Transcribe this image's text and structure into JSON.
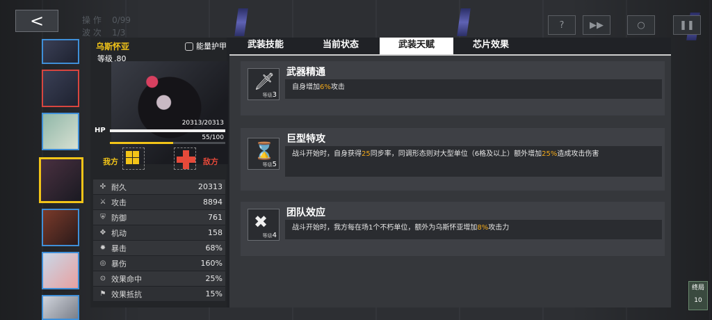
{
  "topbar": {
    "back_label": "<",
    "ops_label": "操 作",
    "ops_value": "0/99",
    "wave_label": "波 次",
    "wave_value": "1/3",
    "buttons": [
      "?",
      "▶▶",
      "○",
      "❚❚"
    ]
  },
  "character": {
    "name": "乌斯怀亚",
    "level_label": "等级",
    "level_value": ".80",
    "armor_label": "能量护甲",
    "hp_label": "HP",
    "hp_text": "20313/20313",
    "hp_fraction": 1.0,
    "energy_text": "55/100",
    "energy_fraction": 0.55,
    "ally_label": "我方",
    "enemy_label": "敌方"
  },
  "stats": [
    {
      "icon": "✣",
      "label": "耐久",
      "value": "20313"
    },
    {
      "icon": "⚔",
      "label": "攻击",
      "value": "8894"
    },
    {
      "icon": "⛨",
      "label": "防御",
      "value": "761"
    },
    {
      "icon": "✥",
      "label": "机动",
      "value": "158"
    },
    {
      "icon": "✹",
      "label": "暴击",
      "value": "68%"
    },
    {
      "icon": "◎",
      "label": "暴伤",
      "value": "160%"
    },
    {
      "icon": "⊙",
      "label": "效果命中",
      "value": "25%"
    },
    {
      "icon": "⚑",
      "label": "效果抵抗",
      "value": "15%"
    }
  ],
  "tabs": [
    "武装技能",
    "当前状态",
    "武装天赋",
    "芯片效果"
  ],
  "active_tab": 2,
  "talents": [
    {
      "title": "武器精通",
      "level_label": "等级",
      "level": "3",
      "desc_parts": [
        "自身增加",
        "6%",
        "攻击"
      ],
      "icon": "sword-icon"
    },
    {
      "title": "巨型特攻",
      "level_label": "等级",
      "level": "5",
      "desc_parts": [
        "战斗开始时，自身获得",
        "25",
        "同步率，同调形态则对大型单位（6格及以上）额外增加",
        "25%",
        "造成攻击伤害"
      ],
      "icon": "giant-icon"
    },
    {
      "title": "团队效应",
      "level_label": "等级",
      "level": "4",
      "desc_parts": [
        "战斗开始时，我方每在场1个不朽单位，额外为乌斯怀亚增加",
        "8%",
        "攻击力"
      ],
      "icon": "team-icon"
    }
  ],
  "corner_badge": {
    "line1": "终局",
    "line2": "10"
  },
  "colors": {
    "accent": "#f2c418",
    "highlight": "#f2a91a",
    "enemy": "#e64a3a",
    "ally_border": "#3f8fd8"
  }
}
